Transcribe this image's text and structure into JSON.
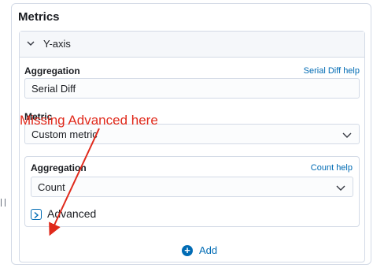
{
  "panel": {
    "title": "Metrics"
  },
  "metric_card": {
    "header_label": "Y-axis",
    "aggregation": {
      "label": "Aggregation",
      "help": "Serial Diff help",
      "value": "Serial Diff"
    },
    "metric": {
      "label": "Metric",
      "value": "Custom metric"
    },
    "inner": {
      "aggregation": {
        "label": "Aggregation",
        "help": "Count help",
        "value": "Count"
      },
      "advanced_label": "Advanced"
    }
  },
  "add_button": {
    "label": "Add"
  },
  "annotation": {
    "text": "Missing Advanced here",
    "color": "#e0291b"
  },
  "colors": {
    "accent": "#006bb4",
    "border": "#d3dae6"
  },
  "icons": [
    "chevron-down-icon",
    "chevron-right-icon",
    "plus-circle-icon",
    "drag-handle-icon"
  ]
}
